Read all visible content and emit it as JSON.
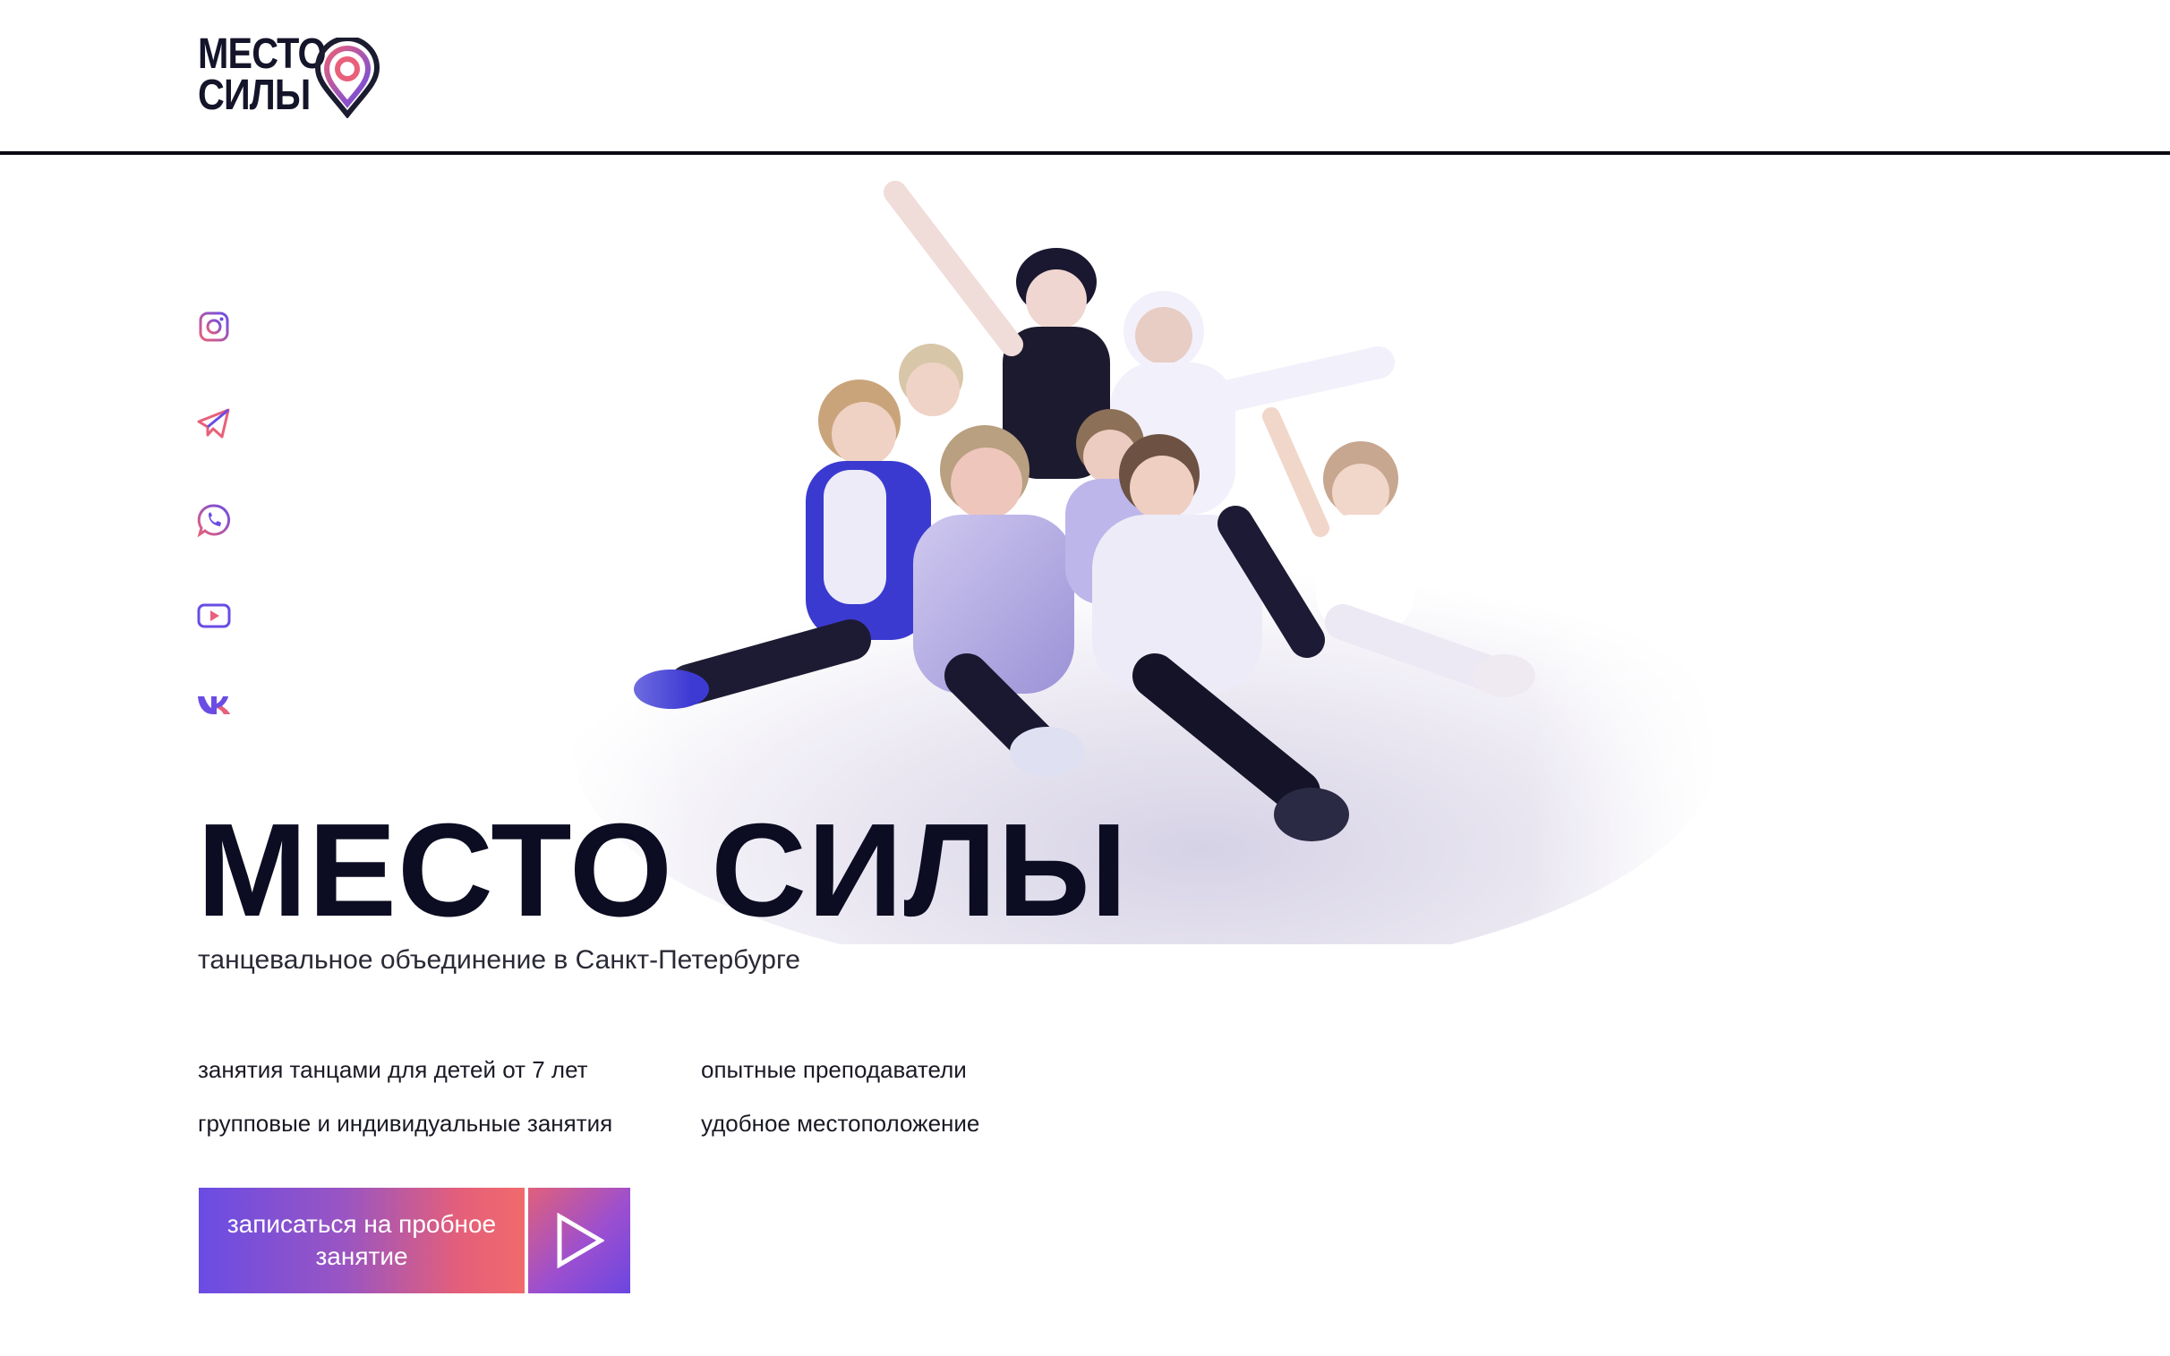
{
  "brand": {
    "logo_line1": "МЕСТО",
    "logo_line2": "СИЛЫ",
    "accent_gradient": [
      "#6a4ce4",
      "#f06a6c"
    ]
  },
  "socials": [
    {
      "name": "instagram-icon",
      "label": "Instagram"
    },
    {
      "name": "telegram-icon",
      "label": "Telegram"
    },
    {
      "name": "whatsapp-icon",
      "label": "WhatsApp"
    },
    {
      "name": "youtube-icon",
      "label": "YouTube"
    },
    {
      "name": "vk-icon",
      "label": "VK"
    }
  ],
  "hero": {
    "title": "МЕСТО СИЛЫ",
    "subtitle": "танцевальное объединение в Санкт-Петербурге",
    "features": [
      "занятия танцами для детей от 7 лет",
      "групповые и индивидуальные занятия",
      "опытные преподаватели",
      "удобное местоположение"
    ],
    "cta_label": "записаться на пробное занятие"
  }
}
